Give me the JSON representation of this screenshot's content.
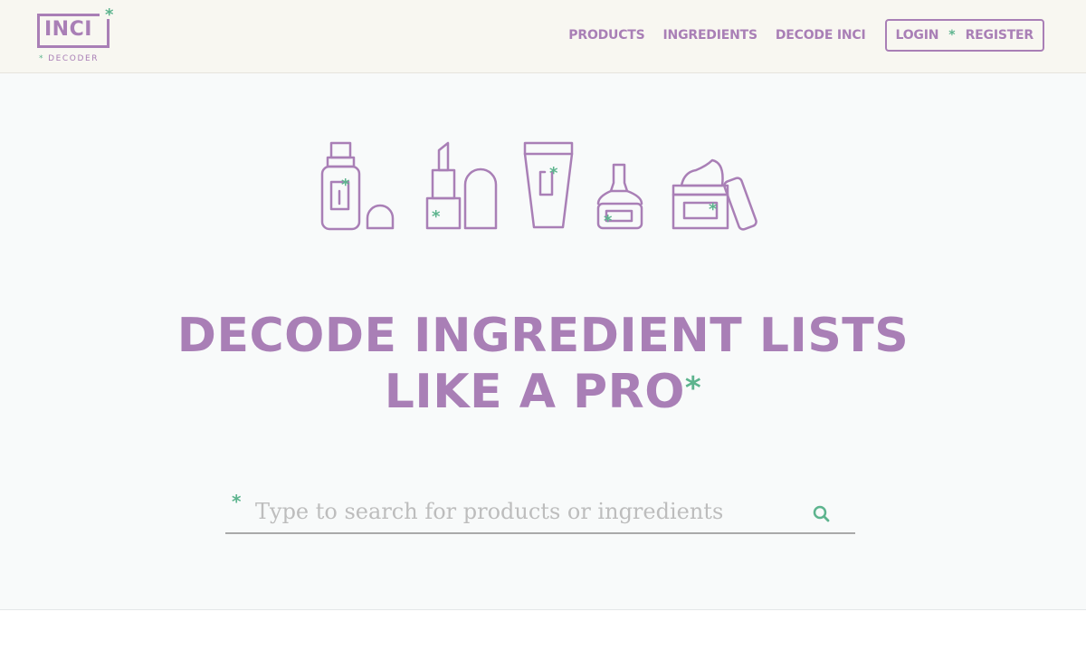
{
  "brand": {
    "name": "INCI",
    "star": "*",
    "subtitle": "DECODER",
    "subtitle_dot": "*",
    "purple": "#a97fb6",
    "green": "#5db48e"
  },
  "nav": {
    "items": [
      {
        "label": "PRODUCTS"
      },
      {
        "label": "INGREDIENTS"
      },
      {
        "label": "DECODE INCI"
      }
    ],
    "login_label": "LOGIN",
    "separator": "*",
    "register_label": "REGISTER"
  },
  "hero": {
    "illustration_icons": [
      "spray-bottle-icon",
      "lipstick-icon",
      "tube-icon",
      "nail-polish-icon",
      "cream-jar-icon"
    ],
    "headline_line1": "DECODE INGREDIENT LISTS",
    "headline_line2": "LIKE A PRO",
    "headline_star": "*"
  },
  "search": {
    "lead_star": "*",
    "placeholder": "Type to search for products or ingredients",
    "value": "",
    "icon": "search-icon"
  }
}
